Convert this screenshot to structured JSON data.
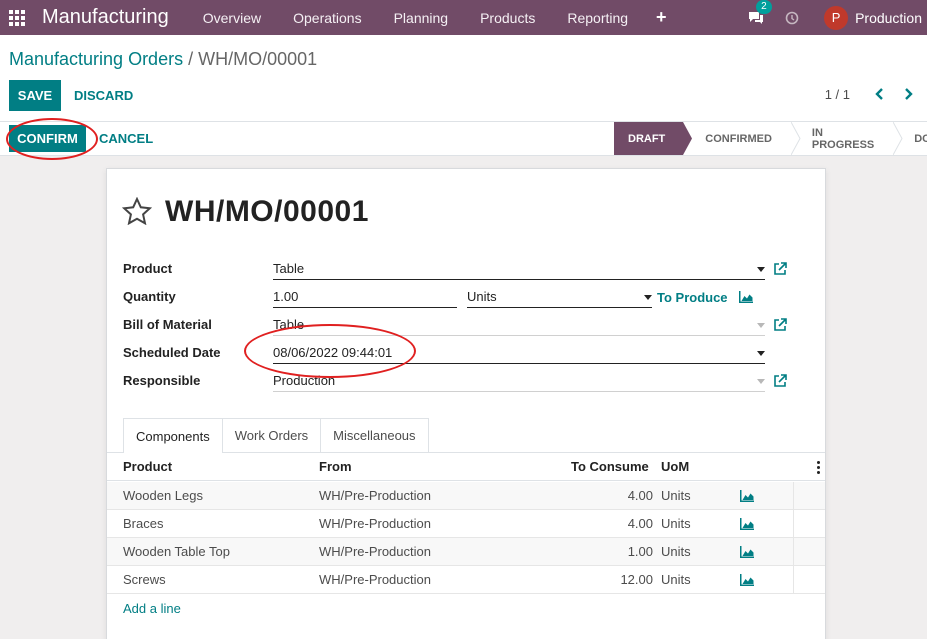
{
  "navbar": {
    "brand": "Manufacturing",
    "menu": [
      "Overview",
      "Operations",
      "Planning",
      "Products",
      "Reporting"
    ],
    "plus": "+",
    "chat_count": "2",
    "avatar_letter": "P",
    "user": "Production"
  },
  "breadcrumb": {
    "parent": "Manufacturing Orders",
    "separator": "/",
    "current": "WH/MO/00001"
  },
  "actions": {
    "save": "SAVE",
    "discard": "DISCARD"
  },
  "pager": {
    "value": "1 / 1"
  },
  "statusbar": {
    "confirm": "CONFIRM",
    "cancel": "CANCEL",
    "stages": [
      "DRAFT",
      "CONFIRMED",
      "IN PROGRESS",
      "DONE"
    ],
    "active_stage": "DRAFT"
  },
  "form": {
    "title": "WH/MO/00001",
    "product_label": "Product",
    "product_value": "Table",
    "quantity_label": "Quantity",
    "quantity_value": "1.00",
    "uom_value": "Units",
    "to_produce": "To Produce",
    "bom_label": "Bill of Material",
    "bom_value": "Table",
    "scheduled_label": "Scheduled Date",
    "scheduled_value": "08/06/2022 09:44:01",
    "responsible_label": "Responsible",
    "responsible_value": "Production"
  },
  "tabs": [
    "Components",
    "Work Orders",
    "Miscellaneous"
  ],
  "components": {
    "headers": {
      "product": "Product",
      "from": "From",
      "to_consume": "To Consume",
      "uom": "UoM"
    },
    "rows": [
      {
        "product": "Wooden Legs",
        "from": "WH/Pre-Production",
        "to_consume": "4.00",
        "uom": "Units"
      },
      {
        "product": "Braces",
        "from": "WH/Pre-Production",
        "to_consume": "4.00",
        "uom": "Units"
      },
      {
        "product": "Wooden Table Top",
        "from": "WH/Pre-Production",
        "to_consume": "1.00",
        "uom": "Units"
      },
      {
        "product": "Screws",
        "from": "WH/Pre-Production",
        "to_consume": "12.00",
        "uom": "Units"
      }
    ],
    "add_line": "Add a line"
  },
  "colors": {
    "brand": "#714b67",
    "primary": "#017e84",
    "annotation": "#e02020"
  },
  "icons": [
    "apps-grid-icon",
    "chat-icon",
    "clock-icon",
    "chevron-left-icon",
    "chevron-right-icon",
    "star-icon",
    "external-link-icon",
    "forecast-chart-icon",
    "kebab-menu-icon",
    "caret-down-icon"
  ]
}
